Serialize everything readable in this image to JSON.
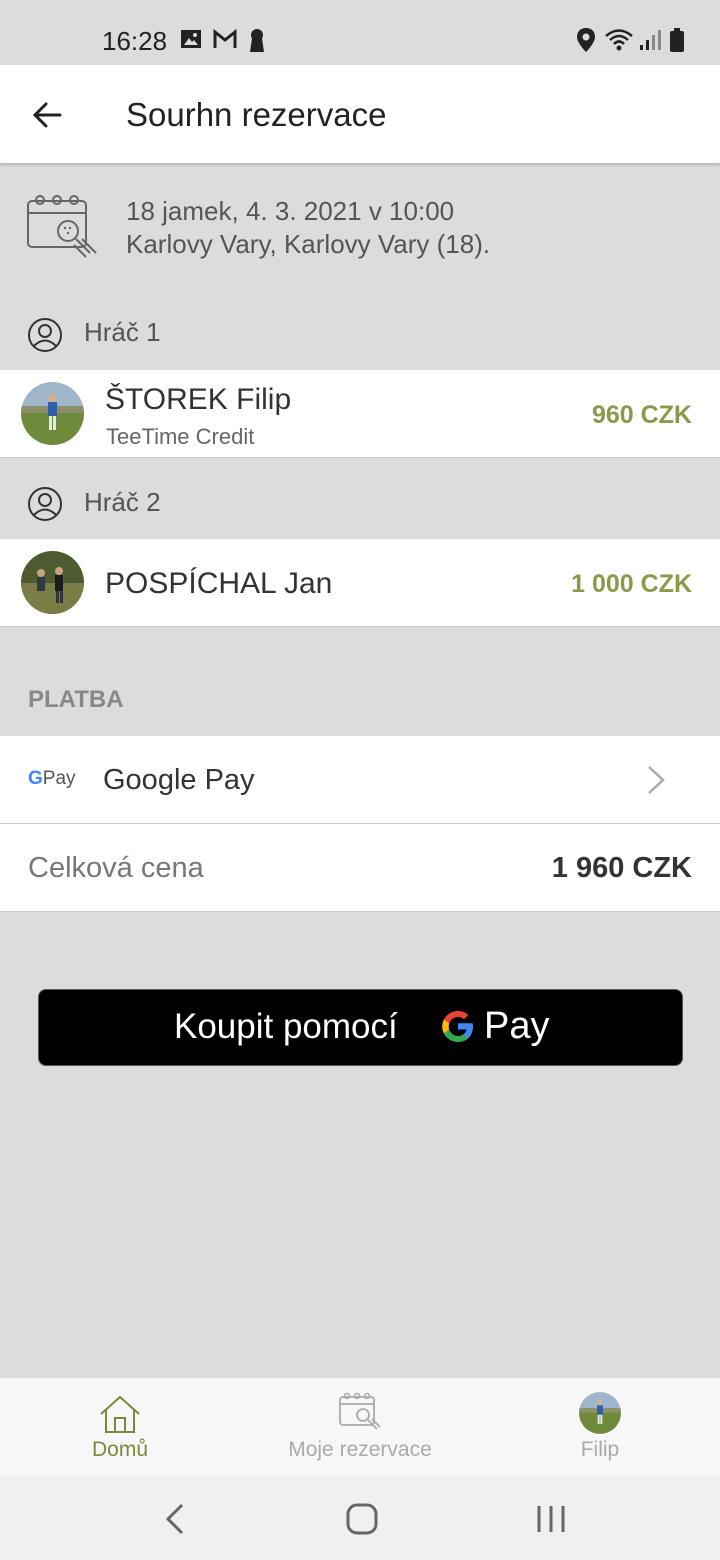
{
  "status_bar": {
    "time": "16:28"
  },
  "app_bar": {
    "title": "Sourhn rezervace"
  },
  "summary": {
    "line1": "18 jamek, 4. 3. 2021 v 10:00",
    "line2": "Karlovy Vary, Karlovy Vary (18)."
  },
  "players": [
    {
      "header": "Hráč 1",
      "name": "ŠTOREK Filip",
      "sub": "TeeTime Credit",
      "price": "960 CZK"
    },
    {
      "header": "Hráč 2",
      "name": "POSPÍCHAL Jan",
      "sub": "",
      "price": "1 000 CZK"
    }
  ],
  "payment": {
    "section_label": "PLATBA",
    "method_logo_g": "G",
    "method_logo_pay": "Pay",
    "method_name": "Google Pay"
  },
  "total": {
    "label": "Celková cena",
    "value": "1 960 CZK"
  },
  "buy_button": {
    "label": "Koupit pomocí",
    "pay": "Pay"
  },
  "bottom_nav": {
    "items": [
      {
        "label": "Domů",
        "icon": "home-icon",
        "active": true
      },
      {
        "label": "Moje rezervace",
        "icon": "calendar-golf-icon",
        "active": false
      },
      {
        "label": "Filip",
        "icon": "avatar",
        "active": false
      }
    ]
  },
  "colors": {
    "accent": "#8a9a4a",
    "background": "#dcdcdc",
    "active_nav": "#7a8a3c",
    "inactive_nav": "#aaaaaa"
  }
}
